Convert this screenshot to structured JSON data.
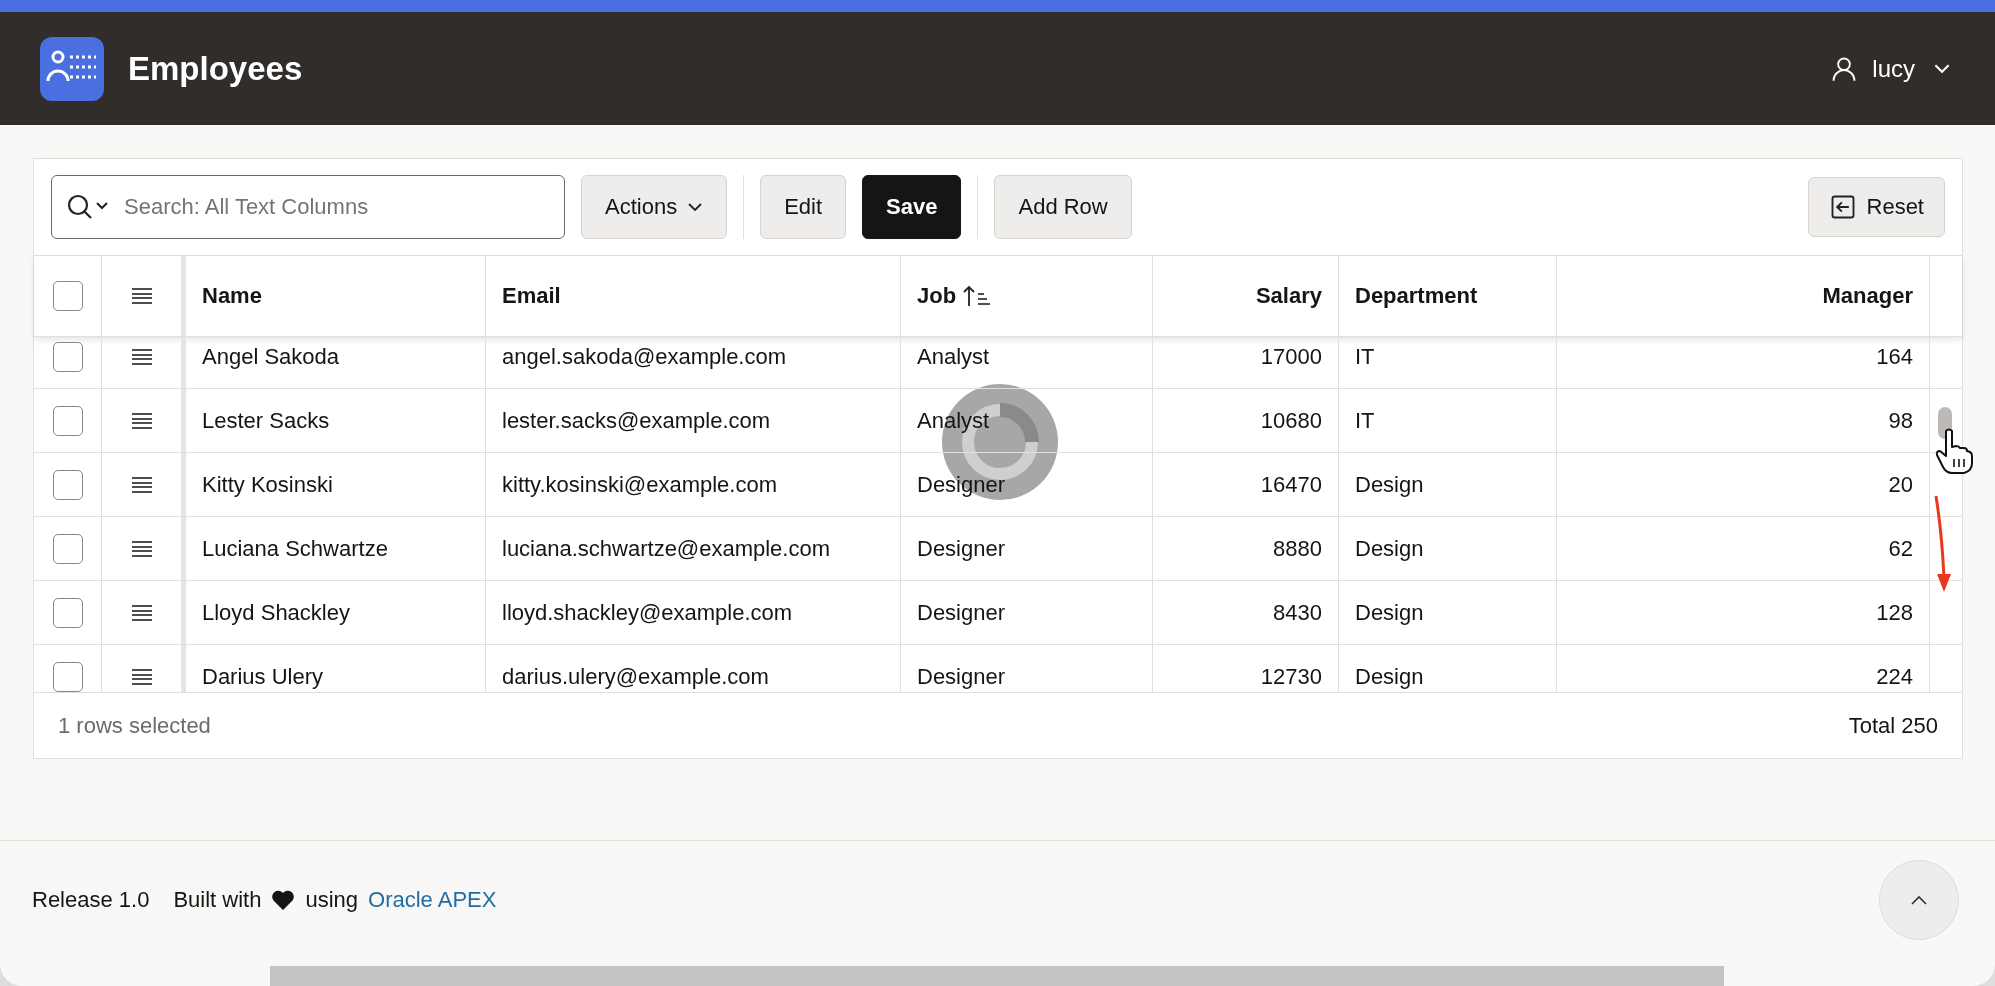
{
  "app": {
    "title": "Employees",
    "user": "lucy"
  },
  "toolbar": {
    "search": {
      "placeholder": "Search: All Text Columns"
    },
    "groups": [
      [
        {
          "label": "Actions",
          "kind": "menu"
        }
      ],
      [
        {
          "label": "Edit",
          "kind": "plain"
        },
        {
          "label": "Save",
          "kind": "primary"
        }
      ],
      [
        {
          "label": "Add Row",
          "kind": "plain"
        }
      ]
    ],
    "reset": {
      "label": "Reset"
    }
  },
  "grid": {
    "select_all_checked": false,
    "columns": [
      {
        "label": "Name",
        "kind": "text",
        "sorted_ascending": false
      },
      {
        "label": "Email",
        "kind": "text",
        "sorted_ascending": false
      },
      {
        "label": "Job",
        "kind": "text",
        "sorted_ascending": true
      },
      {
        "label": "Salary",
        "kind": "number",
        "sorted_ascending": false
      },
      {
        "label": "Department",
        "kind": "text",
        "sorted_ascending": false
      },
      {
        "label": "Manager",
        "kind": "number",
        "sorted_ascending": false
      }
    ],
    "rows": [
      {
        "checked": false,
        "cells": [
          "Angel Sakoda",
          "angel.sakoda@example.com",
          "Analyst",
          "17000",
          "IT",
          "164"
        ]
      },
      {
        "checked": false,
        "cells": [
          "Lester Sacks",
          "lester.sacks@example.com",
          "Analyst",
          "10680",
          "IT",
          "98"
        ]
      },
      {
        "checked": false,
        "cells": [
          "Kitty Kosinski",
          "kitty.kosinski@example.com",
          "Designer",
          "16470",
          "Design",
          "20"
        ]
      },
      {
        "checked": false,
        "cells": [
          "Luciana Schwartze",
          "luciana.schwartze@example.com",
          "Designer",
          "8880",
          "Design",
          "62"
        ]
      },
      {
        "checked": false,
        "cells": [
          "Lloyd Shackley",
          "lloyd.shackley@example.com",
          "Designer",
          "8430",
          "Design",
          "128"
        ]
      },
      {
        "checked": false,
        "cells": [
          "Darius Ulery",
          "darius.ulery@example.com",
          "Designer",
          "12730",
          "Design",
          "224"
        ]
      }
    ],
    "status": "1 rows selected",
    "total": "Total 250"
  },
  "footer": {
    "release": "Release 1.0",
    "built_with": "Built with",
    "using": "using",
    "link": "Oracle APEX"
  }
}
